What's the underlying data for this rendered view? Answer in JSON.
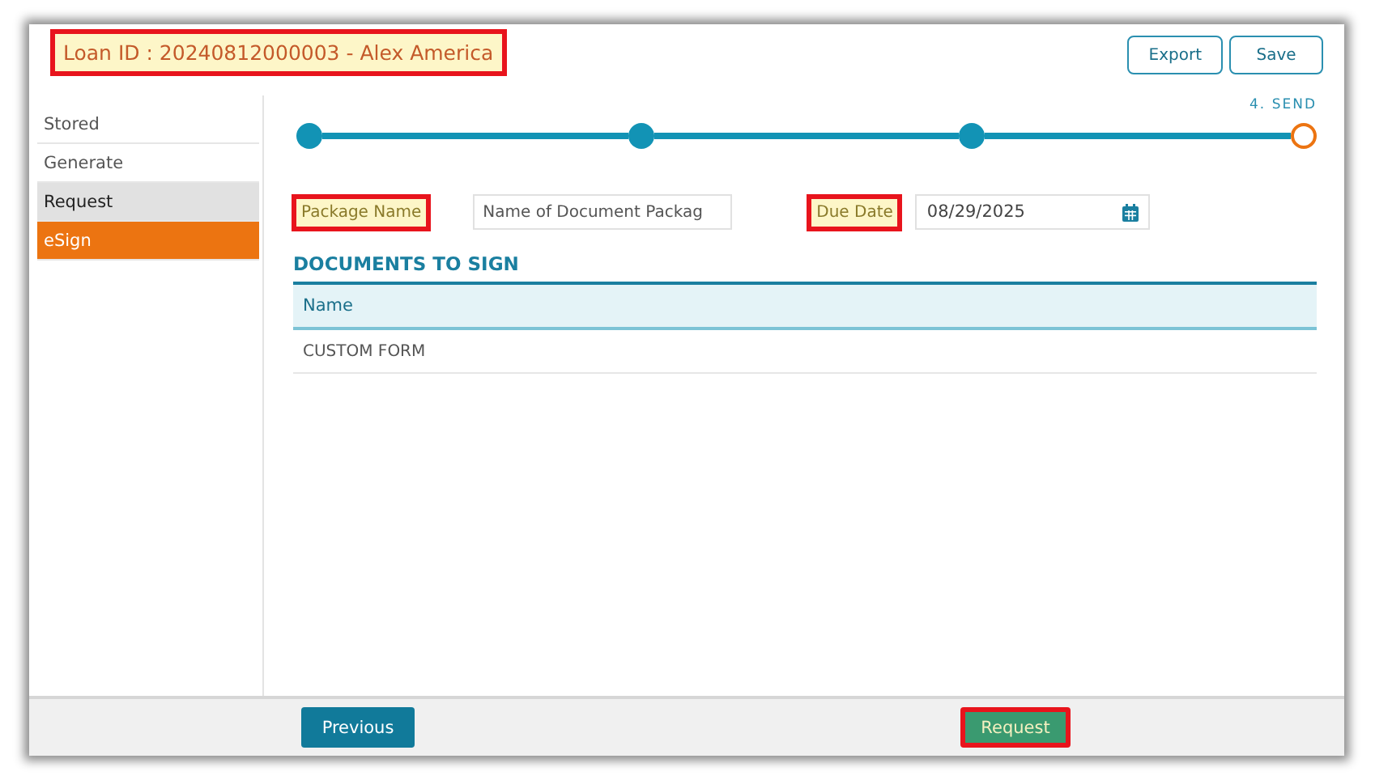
{
  "header": {
    "title": "Loan ID : 20240812000003  - Alex America",
    "highlighted": true,
    "buttons": [
      "Export",
      "Save"
    ]
  },
  "sidebar": {
    "items": [
      {
        "label": "Stored",
        "selected": false,
        "hovered": false
      },
      {
        "label": "Generate",
        "selected": false,
        "hovered": false
      },
      {
        "label": "Request",
        "selected": false,
        "hovered": true
      },
      {
        "label": "eSign",
        "selected": true,
        "hovered": false
      }
    ]
  },
  "stepper": {
    "steps": [
      {
        "current": false
      },
      {
        "current": false
      },
      {
        "current": false
      },
      {
        "label": "4. SEND",
        "current": true
      }
    ]
  },
  "form": {
    "package_name": {
      "label": "Package Name",
      "highlighted": true,
      "placeholder": "Name of Document Packag"
    },
    "due_date": {
      "label": "Due Date",
      "highlighted": true,
      "value": "08/29/2025"
    }
  },
  "documents": {
    "title": "DOCUMENTS TO SIGN",
    "columns": [
      "Name"
    ],
    "rows": [
      [
        "CUSTOM FORM"
      ]
    ]
  },
  "footer": {
    "previous": {
      "label": "Previous",
      "highlighted": false
    },
    "request": {
      "label": "Request",
      "highlighted": true
    }
  }
}
